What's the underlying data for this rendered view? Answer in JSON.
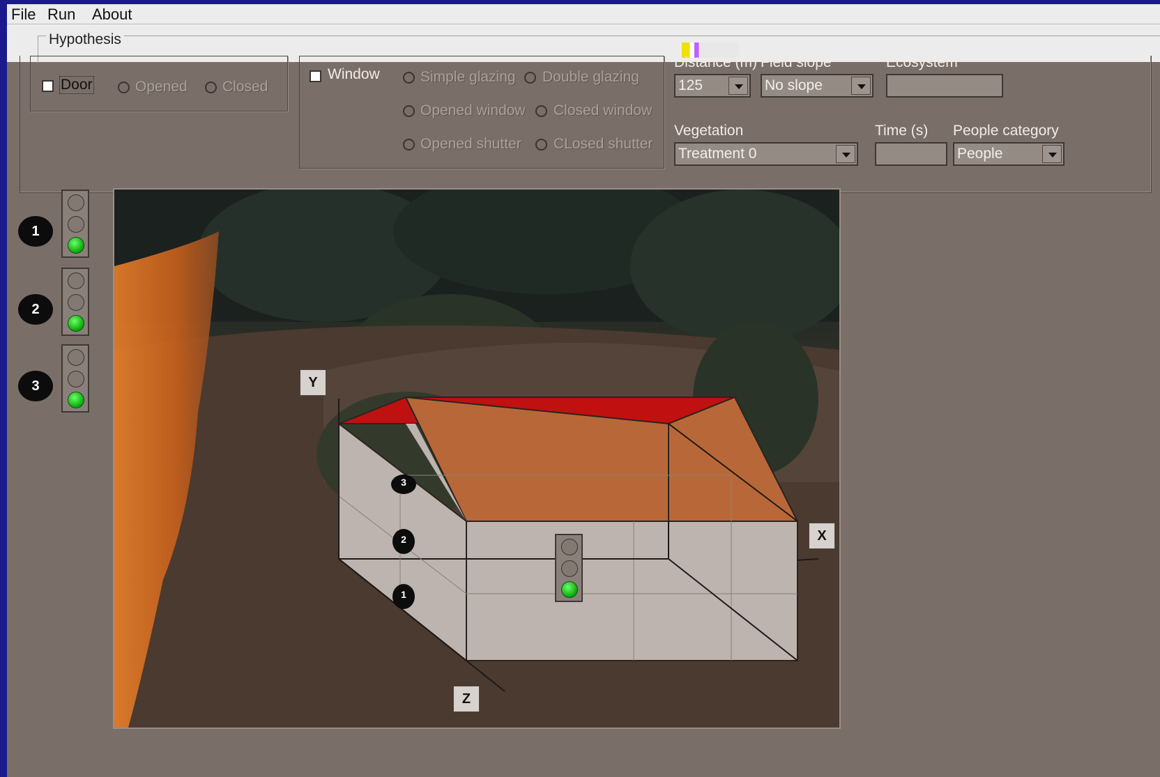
{
  "menu": {
    "file": "File",
    "run": "Run",
    "about": "About"
  },
  "hypothesis": {
    "legend": "Hypothesis",
    "door": {
      "label": "Door",
      "checked": false,
      "options": [
        "Opened",
        "Closed"
      ]
    },
    "window": {
      "label": "Window",
      "checked": false,
      "glazing": [
        "Simple glazing",
        "Double glazing"
      ],
      "state": [
        "Opened window",
        "Closed window"
      ],
      "shutter": [
        "Opened shutter",
        "CLosed shutter"
      ]
    },
    "distance": {
      "label": "Distance (m)",
      "value": "125"
    },
    "field_slope": {
      "label": "Field slope",
      "value": "No slope"
    },
    "ecosystem": {
      "label": "Ecosystem",
      "value": ""
    },
    "vegetation": {
      "label": "Vegetation",
      "value": "Treatment 0"
    },
    "time": {
      "label": "Time (s)",
      "value": ""
    },
    "people_category": {
      "label": "People category",
      "value": "People"
    }
  },
  "indicators": [
    {
      "number": "1",
      "active_light": "green"
    },
    {
      "number": "2",
      "active_light": "green"
    },
    {
      "number": "3",
      "active_light": "green"
    }
  ],
  "scene": {
    "axes": {
      "x": "X",
      "y": "Y",
      "z": "Z"
    },
    "markers": [
      "3",
      "2",
      "1"
    ],
    "house_indicator_active": "green"
  },
  "colors": {
    "roof_top": "#c01010",
    "roof_slope": "#b86838",
    "wall": "#bdb3af",
    "light_on": "#06a806"
  }
}
